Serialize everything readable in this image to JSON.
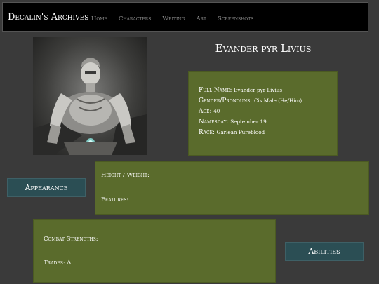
{
  "nav": {
    "brand": "Decalin's Archives",
    "links": [
      "Home",
      "Characters",
      "Writing",
      "Art",
      "Screenshots"
    ]
  },
  "profile": {
    "name": "Evander pyr Livius",
    "fields": [
      {
        "label": "Full Name:",
        "value": "Evander pyr Livius"
      },
      {
        "label": "Gender/Pronouns:",
        "value": "Cis Male (He/Him)"
      },
      {
        "label": "Age:",
        "value": "40"
      },
      {
        "label": "Namesday:",
        "value": "September 19"
      },
      {
        "label": "Race:",
        "value": "Garlean Pureblood"
      }
    ]
  },
  "appearance": {
    "button": "Appearance",
    "height_weight": "Height / Weight:",
    "features": "Features:"
  },
  "abilities": {
    "button": "Abilities",
    "combat_strengths": "Combat Strengths:",
    "trades": "Trades: ∆"
  },
  "colors": {
    "background": "#3a3a3a",
    "panel_green": "#5a6b2c",
    "button_teal": "#2b4e54",
    "nav_black": "#000000"
  }
}
